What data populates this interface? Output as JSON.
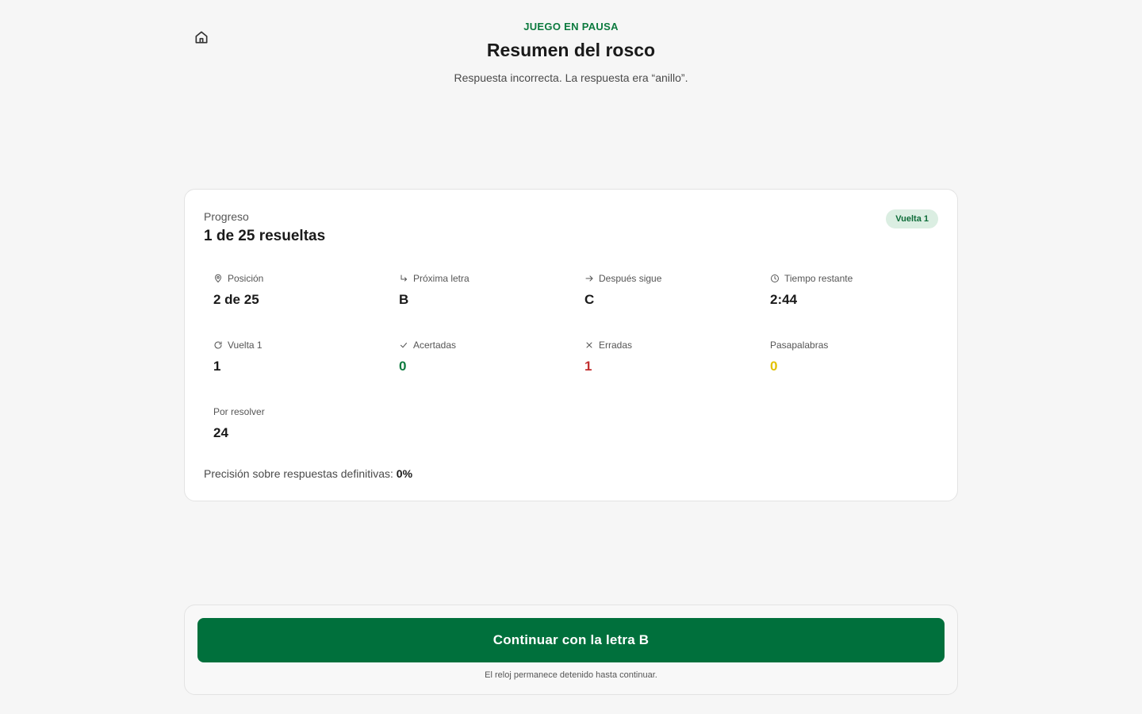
{
  "header": {
    "status": "JUEGO EN PAUSA",
    "title": "Resumen del rosco",
    "subtitle": "Respuesta incorrecta. La respuesta era “anillo”."
  },
  "progress": {
    "label": "Progreso",
    "value": "1 de 25 resueltas",
    "badge": "Vuelta 1"
  },
  "stats": [
    {
      "icon": "location-pin-icon",
      "label": "Posición",
      "value": "2 de 25"
    },
    {
      "icon": "turn-arrow-icon",
      "label": "Próxima letra",
      "value": "B"
    },
    {
      "icon": "arrow-right-icon",
      "label": "Después sigue",
      "value": "C"
    },
    {
      "icon": "clock-icon",
      "label": "Tiempo restante",
      "value": "2:44"
    },
    {
      "icon": "refresh-icon",
      "label": "Vuelta 1",
      "value": "1"
    },
    {
      "icon": "check-icon",
      "label": "Acertadas",
      "value": "0",
      "color": "#0c7a3e"
    },
    {
      "icon": "x-icon",
      "label": "Erradas",
      "value": "1",
      "color": "#c23030"
    },
    {
      "icon": "",
      "label": "Pasapalabras",
      "value": "0",
      "color": "#e2c100"
    },
    {
      "icon": "",
      "label": "Por resolver",
      "value": "24"
    }
  ],
  "precision": {
    "label": "Precisión sobre respuestas definitivas:",
    "value": "0%"
  },
  "footer": {
    "button_label": "Continuar con la letra B",
    "note": "El reloj permanece detenido hasta continuar."
  }
}
